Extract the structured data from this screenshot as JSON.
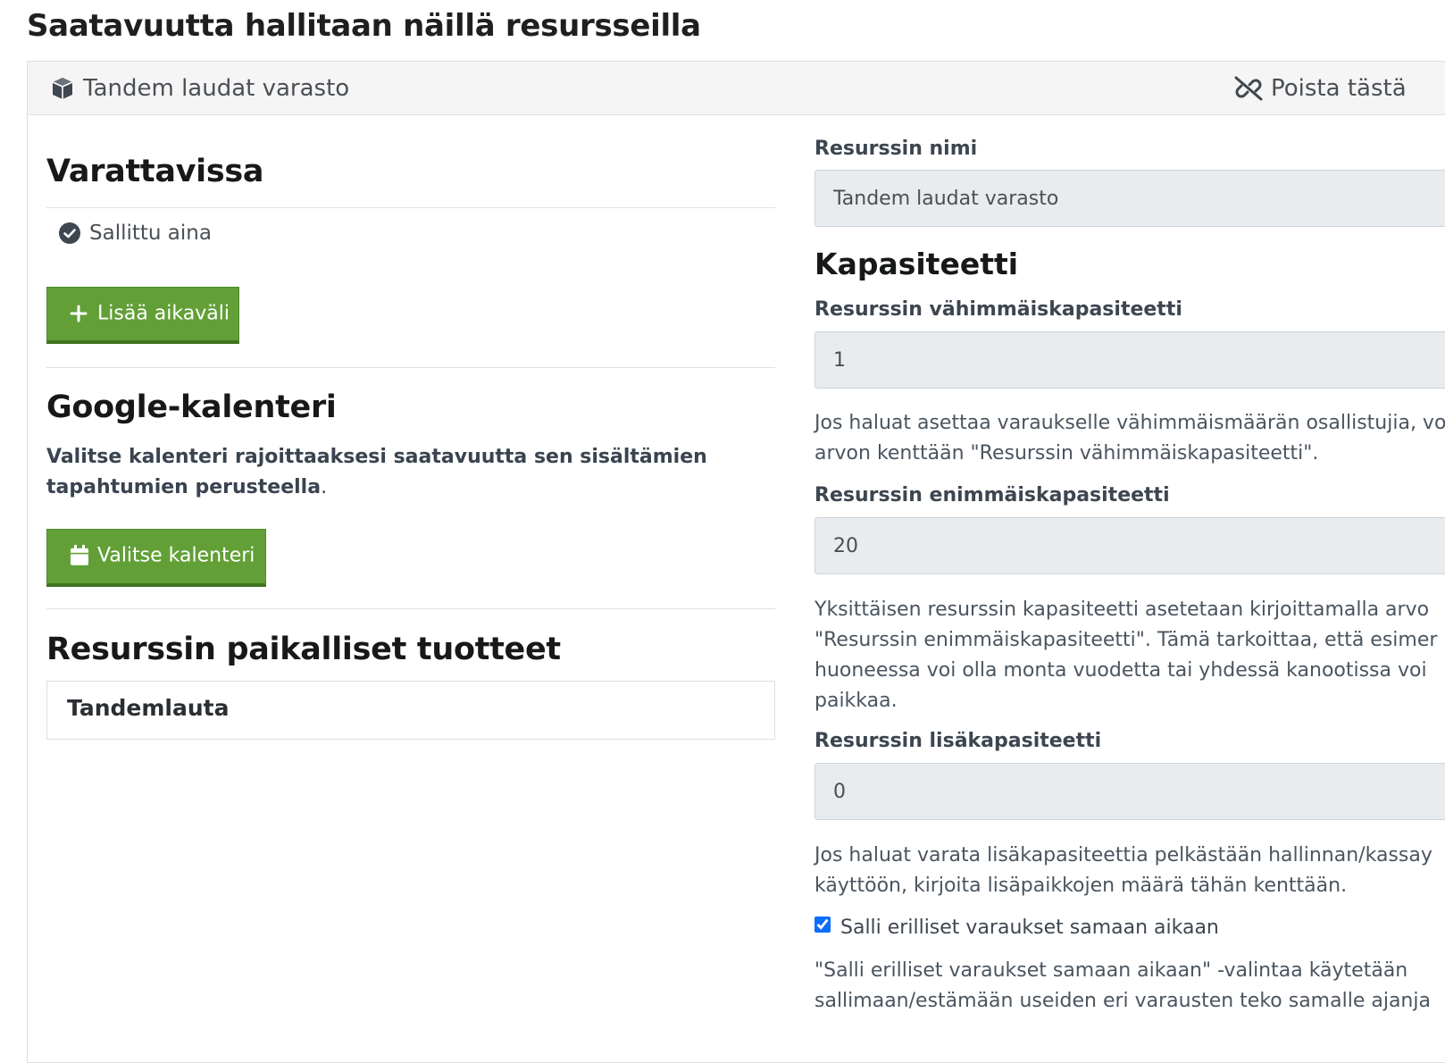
{
  "page": {
    "title": "Saatavuutta hallitaan näillä resursseilla"
  },
  "resource_card": {
    "name": "Tandem laudat varasto",
    "unlink_label": "Poista tästä"
  },
  "availability": {
    "heading": "Varattavissa",
    "rule_label": "Sallittu aina",
    "add_button_label": "Lisää aikaväli"
  },
  "google_calendar": {
    "heading": "Google-kalenteri",
    "description": "Valitse kalenteri rajoittaaksesi saatavuutta sen sisältämien tapahtumien perusteella",
    "description_end": ".",
    "button_label": "Valitse kalenteri"
  },
  "local_products": {
    "heading": "Resurssin paikalliset tuotteet",
    "items": [
      "Tandemlauta"
    ]
  },
  "settings": {
    "name_label": "Resurssin nimi",
    "name_value": "Tandem laudat varasto",
    "capacity_heading": "Kapasiteetti",
    "min_capacity_label": "Resurssin vähimmäiskapasiteetti",
    "min_capacity_value": "1",
    "min_capacity_help": "Jos haluat asettaa varaukselle vähimmäismäärän osallistujia, vo\narvon kenttään \"Resurssin vähimmäiskapasiteetti\".",
    "max_capacity_label": "Resurssin enimmäiskapasiteetti",
    "max_capacity_value": "20",
    "max_capacity_help": "Yksittäisen resurssin kapasiteetti asetetaan kirjoittamalla arvo\n\"Resurssin enimmäiskapasiteetti\". Tämä tarkoittaa, että esimer\nhuoneessa voi olla monta vuodetta tai yhdessä kanootissa voi\npaikkaa.",
    "extra_capacity_label": "Resurssin lisäkapasiteetti",
    "extra_capacity_value": "0",
    "extra_capacity_help": "Jos haluat varata lisäkapasiteettia pelkästään hallinnan/kassay\nkäyttöön, kirjoita lisäpaikkojen määrä tähän kenttään.",
    "allow_concurrent_label": "Salli erilliset varaukset samaan aikaan",
    "allow_concurrent_checked": true,
    "allow_concurrent_help": "\"Salli erilliset varaukset samaan aikaan\" -valintaa käytetään\nsallimaan/estämään useiden eri varausten teko samalle ajanja"
  }
}
